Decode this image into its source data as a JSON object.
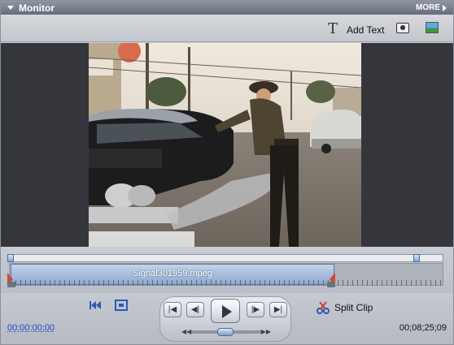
{
  "window": {
    "title": "Monitor",
    "more_label": "MORE"
  },
  "toolbar": {
    "add_text_label": "Add Text",
    "add_text_icon": "text-t-icon",
    "snapshot_icon": "camera-icon",
    "image_icon": "picture-icon"
  },
  "timeline": {
    "clip_name": "Signal301959.mpeg",
    "accent_color": "#8ea8ce",
    "trim_marker_color": "#d2473a"
  },
  "controls": {
    "buttons": [
      {
        "name": "go-to-start",
        "icon": "skip-to-start-icon"
      },
      {
        "name": "fullscreen",
        "icon": "fullscreen-icon"
      },
      {
        "name": "previous-clip",
        "icon": "skip-back-icon",
        "glyph": "|◀"
      },
      {
        "name": "step-back",
        "icon": "step-back-icon",
        "glyph": "◀|"
      },
      {
        "name": "play",
        "icon": "play-icon"
      },
      {
        "name": "step-forward",
        "icon": "step-forward-icon",
        "glyph": "|▶"
      },
      {
        "name": "next-clip",
        "icon": "skip-forward-icon",
        "glyph": "▶|"
      }
    ],
    "split_clip_label": "Split Clip",
    "current_timecode": "00;00;00;00",
    "total_timecode": "00;08;25;09"
  }
}
